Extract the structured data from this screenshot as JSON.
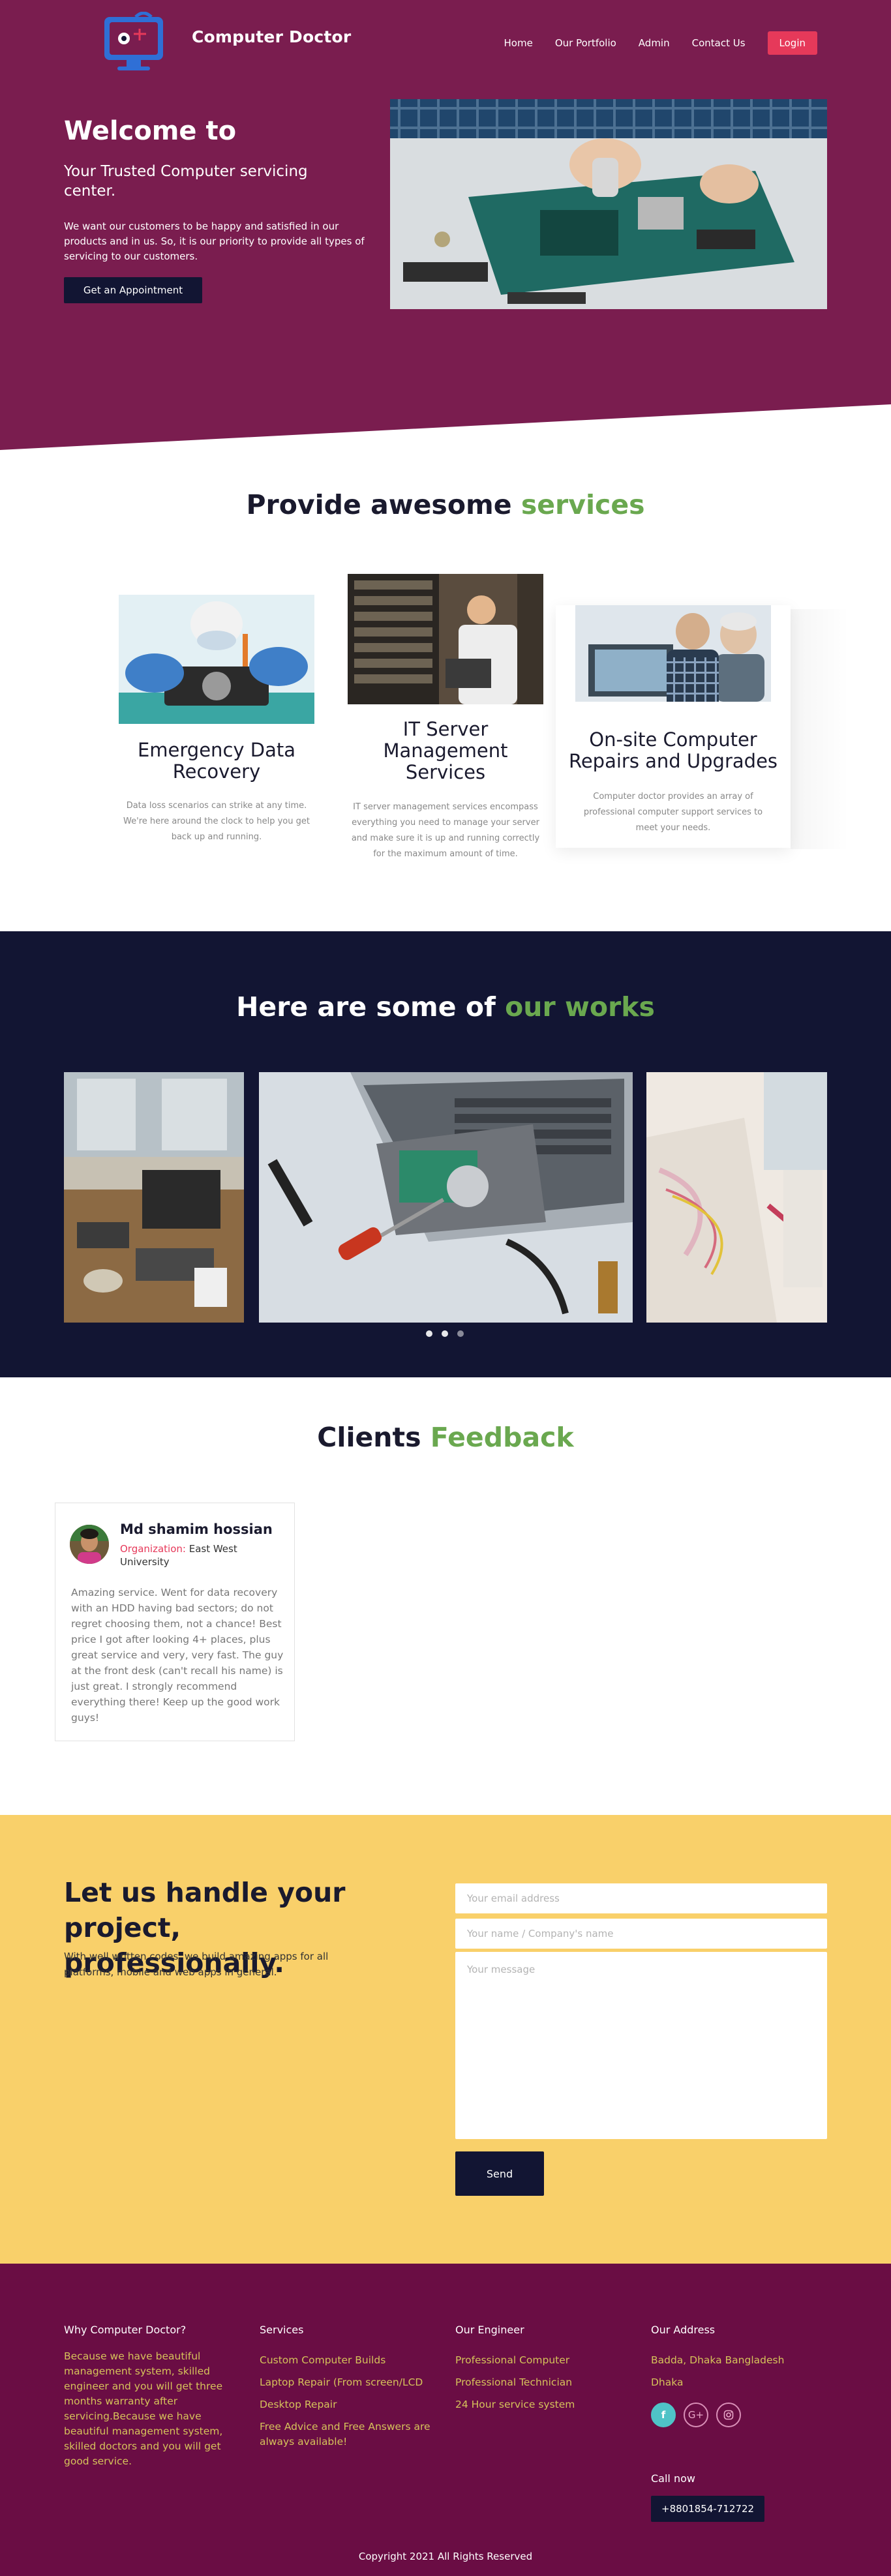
{
  "header": {
    "brand": "Computer Doctor",
    "nav": [
      "Home",
      "Our Portfolio",
      "Admin",
      "Contact Us"
    ],
    "login_label": "Login"
  },
  "hero": {
    "title": "Welcome to",
    "subtitle": "Your Trusted Computer servicing center.",
    "text": "We want our customers to be happy and satisfied in our products and in us. So, it is our priority to provide all types of servicing to our customers.",
    "button_label": "Get an Appointment"
  },
  "services": {
    "title_main": "Provide awesome ",
    "title_accent": "services",
    "items": [
      {
        "title": "Emergency Data Recovery",
        "description": "Data loss scenarios can strike at any time. We're here around the clock to help you get back up and running."
      },
      {
        "title": "IT Server Management Services",
        "description": "IT server management services encompass everything you need to manage your server and make sure it is up and running correctly for the maximum amount of time."
      },
      {
        "title": "On-site Computer Repairs and Upgrades",
        "description": "Computer doctor provides an array of professional computer support services to meet your needs."
      }
    ]
  },
  "works": {
    "title_main": "Here are some of ",
    "title_accent": "our works"
  },
  "feedback": {
    "title_main": "Clients ",
    "title_accent": "Feedback",
    "name": "Md shamim hossian",
    "org_label": "Organization:",
    "org_value": " East West University",
    "text": "Amazing service. Went for data recovery with an HDD having bad sectors; do not regret choosing them, not a chance! Best price I got after looking 4+ places, plus great service and very, very fast. The guy at the front desk (can't recall his name) is just great. I strongly recommend everything there! Keep up the good work guys!"
  },
  "contact": {
    "title": "Let us handle your project, professionally.",
    "text": "With well written codes, we build amazing apps for all platforms, mobile and web apps in general.",
    "email_placeholder": "Your email address",
    "name_placeholder": "Your name / Company's name",
    "message_placeholder": "Your message",
    "send_label": "Send"
  },
  "footer": {
    "col1_title": "Why Computer Doctor?",
    "col1_text": "Because we have beautiful management system, skilled engineer and you will get three months warranty after servicing.Because we have beautiful management system, skilled doctors and you will get good service.",
    "col2_title": "Services",
    "col2_items": [
      "Custom Computer Builds",
      "Laptop Repair (From screen/LCD",
      "Desktop Repair",
      "Free Advice and Free Answers are always available!"
    ],
    "col3_title": "Our Engineer",
    "col3_items": [
      "Professional Computer",
      "Professional Technician",
      "24 Hour service system"
    ],
    "col4_title": "Our Address",
    "col4_items": [
      "Badda, Dhaka Bangladesh",
      "Dhaka"
    ],
    "call_label": "Call now",
    "phone": "+8801854-712722",
    "copyright": "Copyright 2021 All Rights Reserved"
  },
  "colors": {
    "hero_bg": "#7a1d4f",
    "navy": "#121533",
    "accent_green": "#6aa84f",
    "contact_bg": "#f9d06a",
    "footer_bg": "#6a0d44",
    "login_red": "#e6395a"
  }
}
